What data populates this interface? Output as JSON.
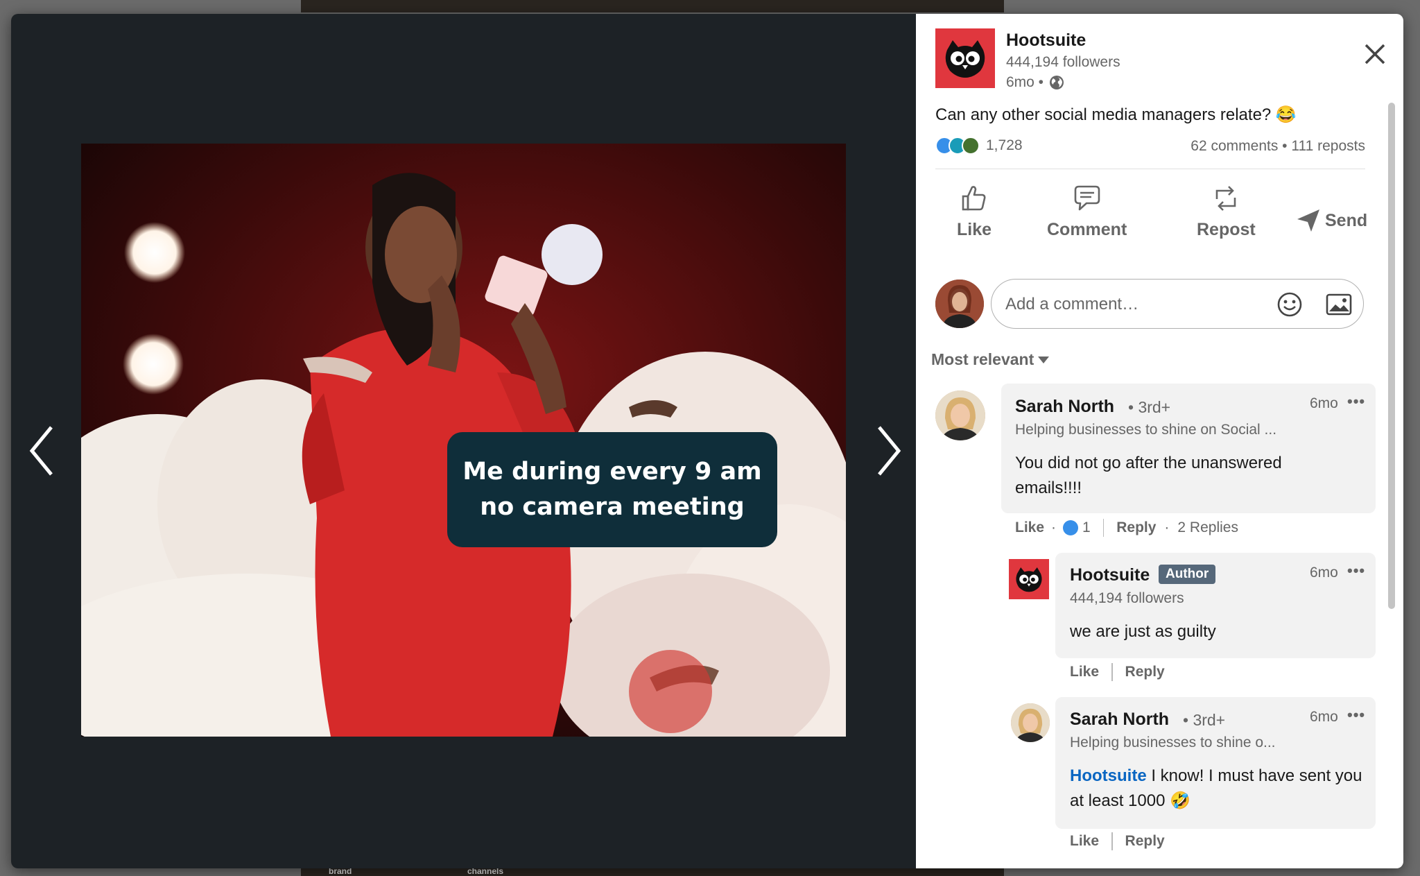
{
  "background": {
    "bottom_labels": [
      "brand",
      "channels"
    ]
  },
  "post": {
    "author": {
      "name": "Hootsuite",
      "followers": "444,194 followers",
      "time": "6mo •"
    },
    "text": "Can any other social media managers relate? 😂",
    "reactions_count": "1,728",
    "comments_reposts": "62 comments • 111 reposts",
    "image_caption": "Me during every 9 am no camera meeting"
  },
  "actions": {
    "like": "Like",
    "comment": "Comment",
    "repost": "Repost",
    "send": "Send"
  },
  "comment_box": {
    "placeholder": "Add a comment…"
  },
  "sort": {
    "label": "Most relevant"
  },
  "comments": [
    {
      "name": "Sarah North",
      "degree": "• 3rd+",
      "headline": "Helping businesses to shine on Social ...",
      "time": "6mo",
      "text": "You did not go after the unanswered emails!!!!",
      "like_label": "Like",
      "like_count": "1",
      "reply_label": "Reply",
      "replies": "2 Replies"
    },
    {
      "name": "Hootsuite",
      "badge": "Author",
      "headline": "444,194 followers",
      "time": "6mo",
      "text": "we are just as guilty",
      "like_label": "Like",
      "reply_label": "Reply"
    },
    {
      "name": "Sarah North",
      "degree": "• 3rd+",
      "headline": "Helping businesses to shine o...",
      "time": "6mo",
      "mention": "Hootsuite",
      "text": " I know! I must have sent you at least 1000 🤣",
      "like_label": "Like",
      "reply_label": "Reply"
    }
  ],
  "more_label": "•••",
  "colors": {
    "brand_red": "#e0373e",
    "link_blue": "#0a66c2",
    "caption_bg": "#0f2e3a",
    "author_badge": "#56687a"
  }
}
